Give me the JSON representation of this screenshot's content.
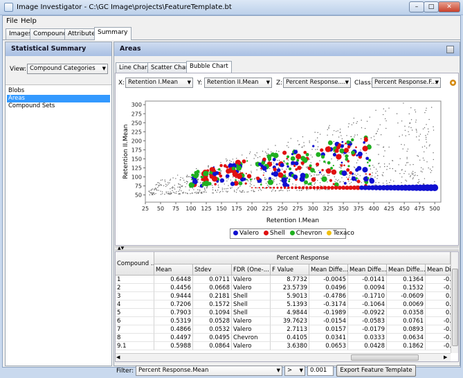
{
  "window": {
    "title": "Image Investigator - C:\\GC Image\\projects\\FeatureTemplate.bt"
  },
  "menu": {
    "file": "File",
    "help": "Help"
  },
  "tabs": [
    "Images",
    "Compounds",
    "Attributes",
    "Summary"
  ],
  "left": {
    "title": "Statistical Summary",
    "view_label": "View:",
    "view_value": "Compound Categories",
    "items": [
      "Blobs",
      "Areas",
      "Compound Sets"
    ]
  },
  "right": {
    "title": "Areas",
    "chart_tabs": [
      "Line Chart",
      "Scatter Chart",
      "Bubble Chart"
    ],
    "x_label": "X:",
    "x_value": "Retention I.Mean",
    "y_label": "Y:",
    "y_value": "Retention II.Mean",
    "z_label": "Z:",
    "z_value": "Percent Response....",
    "class_label": "Class:",
    "class_value": "Percent Response.F..."
  },
  "chart_data": {
    "type": "scatter",
    "title": "",
    "xlabel": "Retention I.Mean",
    "ylabel": "Retention II.Mean",
    "xlim": [
      25,
      510
    ],
    "ylim": [
      30,
      310
    ],
    "xticks": [
      25,
      50,
      75,
      100,
      125,
      150,
      175,
      200,
      225,
      250,
      275,
      300,
      325,
      350,
      375,
      400,
      425,
      450,
      475,
      500
    ],
    "yticks": [
      50,
      75,
      100,
      125,
      150,
      175,
      200,
      225,
      250,
      275,
      300
    ],
    "legend_position": "bottom",
    "series": [
      {
        "name": "Valero",
        "color": "#1010d0"
      },
      {
        "name": "Shell",
        "color": "#e01010"
      },
      {
        "name": "Chevron",
        "color": "#20b020"
      },
      {
        "name": "Texaco",
        "color": "#f0c010"
      }
    ]
  },
  "table": {
    "group_header": "Percent Response",
    "first_col_header": "Compound ...",
    "columns": [
      "Mean",
      "Stdev",
      "FDR (One-...",
      "F Value",
      "Mean Diffe...",
      "Mean Diffe...",
      "Mean Diffe...",
      "Mean Di"
    ],
    "rows": [
      [
        "1",
        "0.6448",
        "0.0711",
        "Valero",
        "8.7732",
        "-0.0045",
        "-0.0141",
        "0.1364",
        "-0."
      ],
      [
        "2",
        "0.4456",
        "0.0668",
        "Valero",
        "23.5739",
        "0.0496",
        "0.0094",
        "0.1532",
        "-0."
      ],
      [
        "3",
        "0.9444",
        "0.2181",
        "Shell",
        "5.9013",
        "-0.4786",
        "-0.1710",
        "-0.0609",
        "0."
      ],
      [
        "4",
        "0.7206",
        "0.1572",
        "Shell",
        "5.1393",
        "-0.3174",
        "-0.1064",
        "0.0069",
        "0."
      ],
      [
        "5",
        "0.7903",
        "0.1094",
        "Shell",
        "4.9844",
        "-0.1989",
        "-0.0922",
        "0.0358",
        "0."
      ],
      [
        "6",
        "0.5319",
        "0.0528",
        "Valero",
        "39.7623",
        "-0.0154",
        "-0.0583",
        "0.0761",
        "-0."
      ],
      [
        "7",
        "0.4866",
        "0.0532",
        "Valero",
        "2.7113",
        "0.0157",
        "-0.0179",
        "0.0893",
        "-0."
      ],
      [
        "8",
        "0.4497",
        "0.0495",
        "Chevron",
        "0.4105",
        "0.0341",
        "0.0333",
        "0.0634",
        "-0."
      ],
      [
        "9.1",
        "0.5988",
        "0.0864",
        "Valero",
        "3.6380",
        "0.0653",
        "0.0428",
        "0.1862",
        "-0."
      ]
    ]
  },
  "filter": {
    "label": "Filter:",
    "field": "Percent Response.Mean",
    "operator": ">",
    "value": "0.001",
    "export_label": "Export Feature Template"
  }
}
